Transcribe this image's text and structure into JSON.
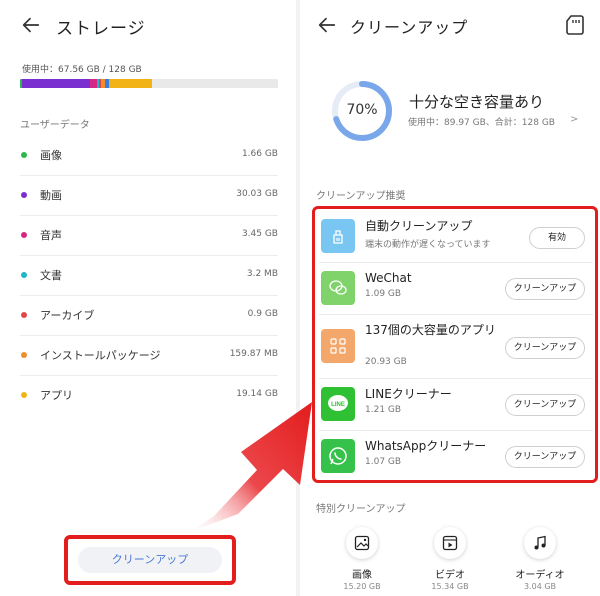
{
  "left": {
    "title": "ストレージ",
    "usage_text": "使用中：67.56 GB / 128 GB",
    "section_label": "ユーザーデータ",
    "categories": [
      {
        "name": "画像",
        "size": "1.66 GB",
        "color": "#2db84b"
      },
      {
        "name": "動画",
        "size": "30.03 GB",
        "color": "#7a2fd1"
      },
      {
        "name": "音声",
        "size": "3.45 GB",
        "color": "#d62784"
      },
      {
        "name": "文書",
        "size": "3.2 MB",
        "color": "#1fb6c8"
      },
      {
        "name": "アーカイブ",
        "size": "0.9 GB",
        "color": "#e34848"
      },
      {
        "name": "インストールパッケージ",
        "size": "159.87 MB",
        "color": "#ef8d2e"
      },
      {
        "name": "アプリ",
        "size": "19.14 GB",
        "color": "#f2b316"
      }
    ],
    "cleanup_button": "クリーンアップ"
  },
  "right": {
    "title": "クリーンアップ",
    "usage_percent": "70%",
    "usage_fraction": 0.7,
    "ring_color": "#7aa6ea",
    "status_title": "十分な空き容量あり",
    "status_sub": "使用中：89.97 GB、合計：128 GB",
    "recommend_label": "クリーンアップ推奨",
    "recommendations": [
      {
        "name": "自動クリーンアップ",
        "sub": "端末の動作が遅くなっています",
        "button": "有効",
        "icon_color": "#79c6f2",
        "icon": "auto-clean-icon"
      },
      {
        "name": "WeChat",
        "sub": "1.09 GB",
        "button": "クリーンアップ",
        "icon_color": "#7fd36a",
        "icon": "wechat-icon"
      },
      {
        "name": "137個の大容量のアプリ",
        "sub": "20.93 GB",
        "button": "クリーンアップ",
        "icon_color": "#f4a76a",
        "icon": "apps-grid-icon"
      },
      {
        "name": "LINEクリーナー",
        "sub": "1.21 GB",
        "button": "クリーンアップ",
        "icon_color": "#2fc034",
        "icon": "line-icon"
      },
      {
        "name": "WhatsAppクリーナー",
        "sub": "1.07 GB",
        "button": "クリーンアップ",
        "icon_color": "#36c24a",
        "icon": "whatsapp-icon"
      }
    ],
    "special_label": "特別クリーンアップ",
    "special": [
      {
        "name": "画像",
        "size": "15.20 GB",
        "icon": "image-icon"
      },
      {
        "name": "ビデオ",
        "size": "15.34 GB",
        "icon": "video-icon"
      },
      {
        "name": "オーディオ",
        "size": "3.04 GB",
        "icon": "music-icon"
      }
    ]
  },
  "highlight_color": "#e31c1c"
}
